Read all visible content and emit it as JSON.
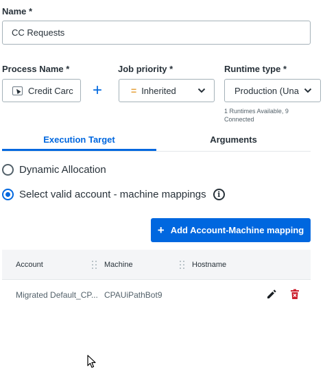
{
  "form": {
    "name_label": "Name *",
    "name_value": "CC Requests",
    "process_label": "Process Name *",
    "process_value": "Credit Carc",
    "priority_label": "Job priority *",
    "priority_value": "Inherited",
    "runtime_label": "Runtime type *",
    "runtime_value": "Production (Una",
    "runtime_info": "1 Runtimes Available, 9 Connected"
  },
  "tabs": [
    {
      "label": "Execution Target",
      "active": true
    },
    {
      "label": "Arguments",
      "active": false
    }
  ],
  "allocation": {
    "dynamic_label": "Dynamic Allocation",
    "select_label": "Select valid account - machine mappings"
  },
  "add_button_label": "Add Account-Machine mapping",
  "table": {
    "headers": [
      "Account",
      "Machine",
      "Hostname"
    ],
    "rows": [
      {
        "account": "Migrated Default_CP...",
        "machine": "CPAUiPathBot9",
        "hostname": ""
      }
    ]
  },
  "colors": {
    "accent": "#0067df",
    "delete": "#cc1f2d",
    "priority_mark": "#e6a23c"
  },
  "icons": [
    "process-icon",
    "plus-icon",
    "chevron-down-icon",
    "info-icon",
    "edit-icon",
    "delete-icon",
    "mouse-cursor-icon"
  ]
}
